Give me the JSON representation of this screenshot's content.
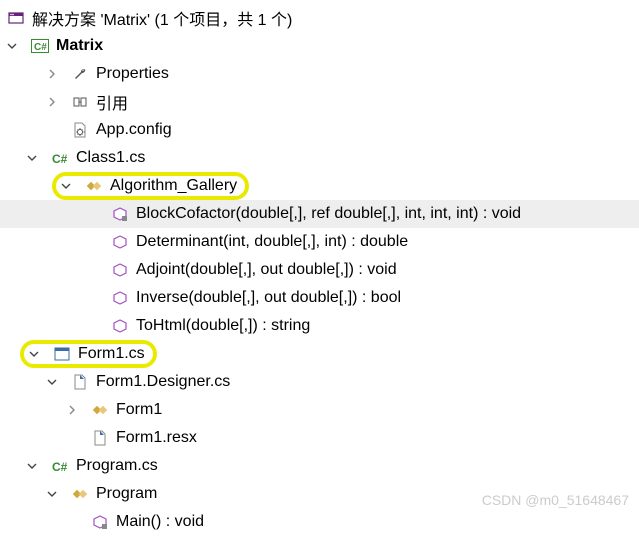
{
  "solution": {
    "title": "解决方案 'Matrix' (1 个项目，共 1 个)",
    "project": "Matrix",
    "nodes": {
      "properties": "Properties",
      "references": "引用",
      "appconfig": "App.config",
      "class1": "Class1.cs",
      "algGallery": "Algorithm_Gallery",
      "methods": [
        "BlockCofactor(double[,], ref double[,], int, int, int) : void",
        "Determinant(int, double[,], int) : double",
        "Adjoint(double[,], out double[,]) : void",
        "Inverse(double[,], out double[,]) : bool",
        "ToHtml(double[,]) : string"
      ],
      "form1": "Form1.cs",
      "form1designer": "Form1.Designer.cs",
      "form1class": "Form1",
      "form1resx": "Form1.resx",
      "program": "Program.cs",
      "programClass": "Program",
      "main": "Main() : void"
    }
  },
  "watermark": "CSDN @m0_51648467"
}
